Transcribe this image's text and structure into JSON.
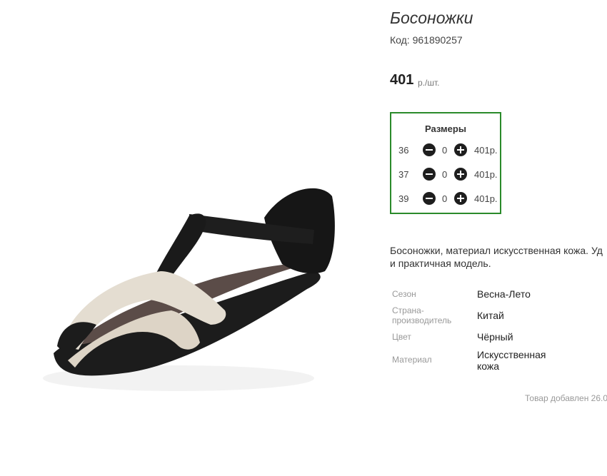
{
  "product": {
    "title": "Босоножки",
    "code": "Код: 961890257",
    "price": "401",
    "price_unit": "р./шт.",
    "description_line1": "Босоножки, материал искусственная кожа. Уд",
    "description_line2": "и практичная модель.",
    "added_text": "Товар добавлен 26.0",
    "image": {
      "icon": "sandal-image"
    }
  },
  "sizes": {
    "title": "Размеры",
    "rows": [
      {
        "size": "36",
        "qty": "0",
        "price": "401р."
      },
      {
        "size": "37",
        "qty": "0",
        "price": "401р."
      },
      {
        "size": "39",
        "qty": "0",
        "price": "401р."
      }
    ],
    "border_color": "#2a8a2a"
  },
  "attributes": [
    {
      "label": "Сезон",
      "value": "Весна-Лето"
    },
    {
      "label_line1": "Страна-",
      "label_line2": "производитель",
      "value": "Китай"
    },
    {
      "label": "Цвет",
      "value": "Чёрный"
    },
    {
      "label": "Материал",
      "value_line1": "Искусственная",
      "value_line2": "кожа"
    }
  ]
}
